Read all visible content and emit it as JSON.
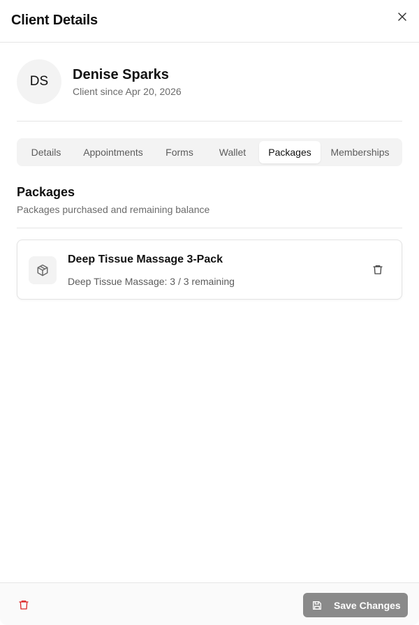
{
  "modal": {
    "title": "Client Details"
  },
  "client": {
    "initials": "DS",
    "name": "Denise Sparks",
    "since": "Client since Apr 20, 2026"
  },
  "tabs": [
    {
      "label": "Details"
    },
    {
      "label": "Appointments"
    },
    {
      "label": "Forms"
    },
    {
      "label": "Wallet"
    },
    {
      "label": "Packages",
      "active": true
    },
    {
      "label": "Memberships"
    }
  ],
  "packages_section": {
    "title": "Packages",
    "description": "Packages purchased and remaining balance",
    "items": [
      {
        "name": "Deep Tissue Massage 3-Pack",
        "remaining": "Deep Tissue Massage: 3 / 3 remaining",
        "icon": "package-icon"
      }
    ]
  },
  "footer": {
    "save_label": "Save Changes"
  },
  "colors": {
    "danger": "#dc2626",
    "save_button_bg": "#8a8a8a",
    "tab_track": "#f3f3f3"
  }
}
